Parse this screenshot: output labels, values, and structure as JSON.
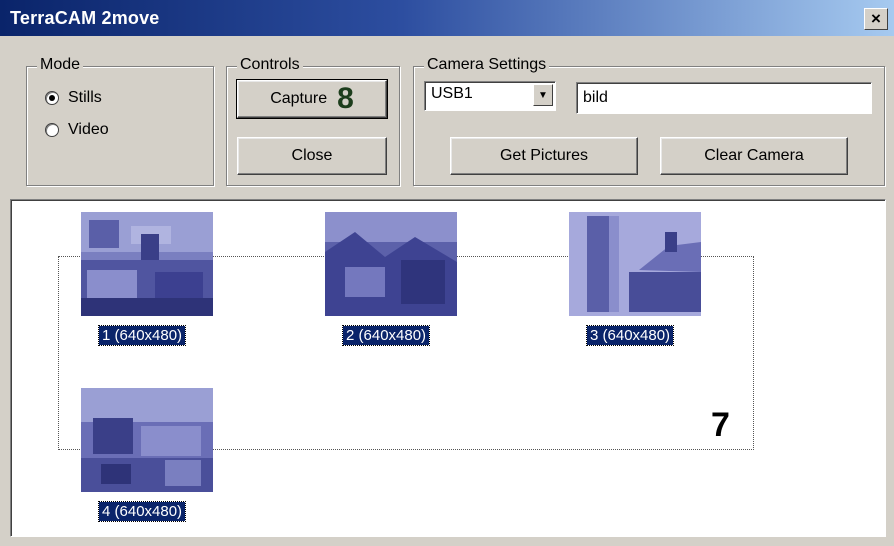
{
  "window": {
    "title": "TerraCAM 2move",
    "close_glyph": "×"
  },
  "mode": {
    "label": "Mode",
    "options": [
      {
        "label": "Stills",
        "selected": true
      },
      {
        "label": "Video",
        "selected": false
      }
    ]
  },
  "controls": {
    "label": "Controls",
    "capture_label": "Capture",
    "capture_callout": "8",
    "close_label": "Close"
  },
  "camera_settings": {
    "label": "Camera Settings",
    "port_value": "USB1",
    "filename_value": "bild",
    "get_pictures_label": "Get Pictures",
    "clear_camera_label": "Clear Camera"
  },
  "gallery": {
    "callout": "7",
    "items": [
      {
        "caption": "1 (640x480)"
      },
      {
        "caption": "2 (640x480)"
      },
      {
        "caption": "3 (640x480)"
      },
      {
        "caption": "4 (640x480)"
      }
    ]
  },
  "colors": {
    "window_bg": "#d4d0c8",
    "title_bar": "#0a246a",
    "selection": "#0a246a",
    "thumb_tint": "#4a4f9a"
  }
}
